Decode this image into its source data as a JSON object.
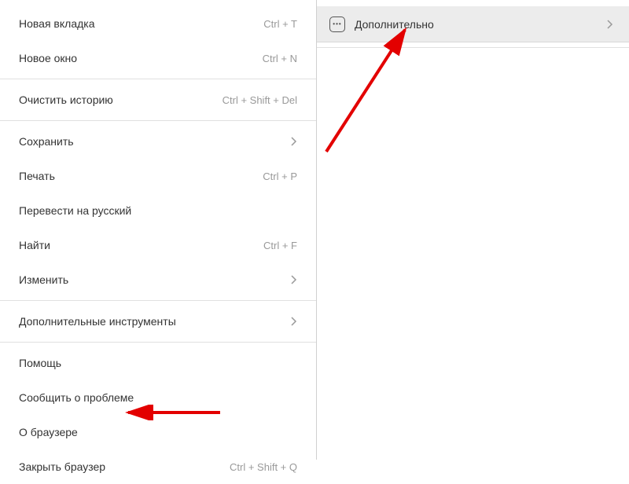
{
  "leftMenu": {
    "group1": [
      {
        "label": "Новая вкладка",
        "shortcut": "Ctrl + T"
      },
      {
        "label": "Новое окно",
        "shortcut": "Ctrl + N"
      }
    ],
    "group2": [
      {
        "label": "Очистить историю",
        "shortcut": "Ctrl + Shift + Del"
      }
    ],
    "group3": [
      {
        "label": "Сохранить",
        "hasChevron": true
      },
      {
        "label": "Печать",
        "shortcut": "Ctrl + P"
      },
      {
        "label": "Перевести на русский"
      },
      {
        "label": "Найти",
        "shortcut": "Ctrl + F"
      },
      {
        "label": "Изменить",
        "hasChevron": true
      }
    ],
    "group4": [
      {
        "label": "Дополнительные инструменты",
        "hasChevron": true
      }
    ],
    "group5": [
      {
        "label": "Помощь"
      },
      {
        "label": "Сообщить о проблеме"
      },
      {
        "label": "О браузере"
      },
      {
        "label": "Закрыть браузер",
        "shortcut": "Ctrl + Shift + Q"
      }
    ]
  },
  "rightMenu": {
    "item": {
      "label": "Дополнительно"
    }
  }
}
